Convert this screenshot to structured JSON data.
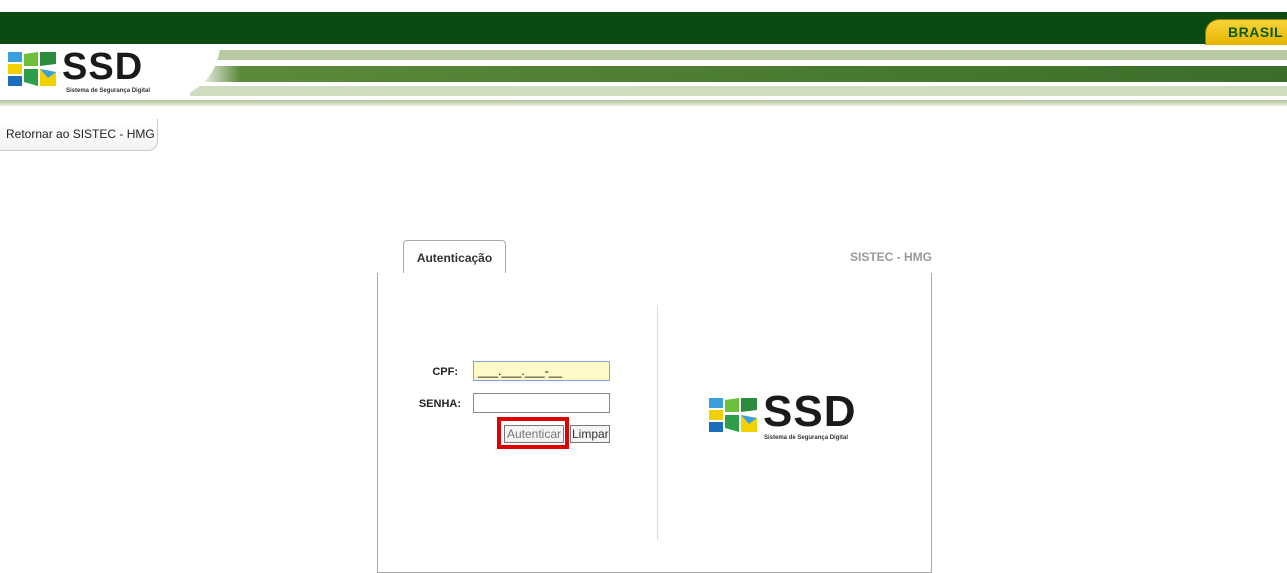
{
  "gov_bar": {
    "brasil_label": "BRASIL"
  },
  "header": {
    "logo_text": "SSD",
    "logo_subtitle": "Sistema de Segurança Digital"
  },
  "nav": {
    "back_link": "Retornar ao SISTEC - HMG"
  },
  "panel": {
    "tab_label": "Autenticação",
    "system_label": "SISTEC - HMG",
    "cpf_label": "CPF:",
    "cpf_value": "___.___.___-__",
    "senha_label": "SENHA:",
    "senha_value": "",
    "authenticate_button": "Autenticar",
    "clear_button": "Limpar",
    "logo_text": "SSD",
    "logo_subtitle": "Sistema de Segurança Digital"
  },
  "colors": {
    "gov_green": "#0b4a10",
    "brasil_yellow": "#f8d43a",
    "highlight_red": "#e00000",
    "cpf_field_bg": "#fff9c7"
  }
}
